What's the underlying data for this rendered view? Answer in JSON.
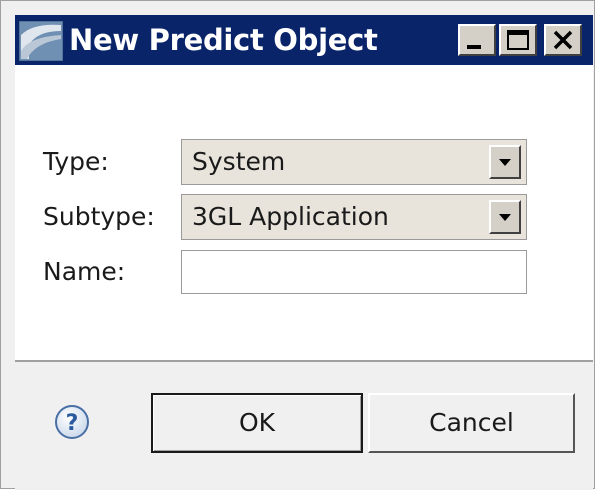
{
  "window": {
    "title": "New Predict Object",
    "title_bar_color": "#0a246a",
    "app_icon": "wizard-icon",
    "controls": {
      "minimize_icon": "minimize-icon",
      "maximize_icon": "maximize-icon",
      "close_icon": "close-icon"
    }
  },
  "form": {
    "type": {
      "label": "Type:",
      "value": "System"
    },
    "subtype": {
      "label": "Subtype:",
      "value": "3GL Application"
    },
    "name": {
      "label": "Name:",
      "value": ""
    }
  },
  "footer": {
    "help_icon": "help-icon",
    "ok_label": "OK",
    "cancel_label": "Cancel"
  }
}
